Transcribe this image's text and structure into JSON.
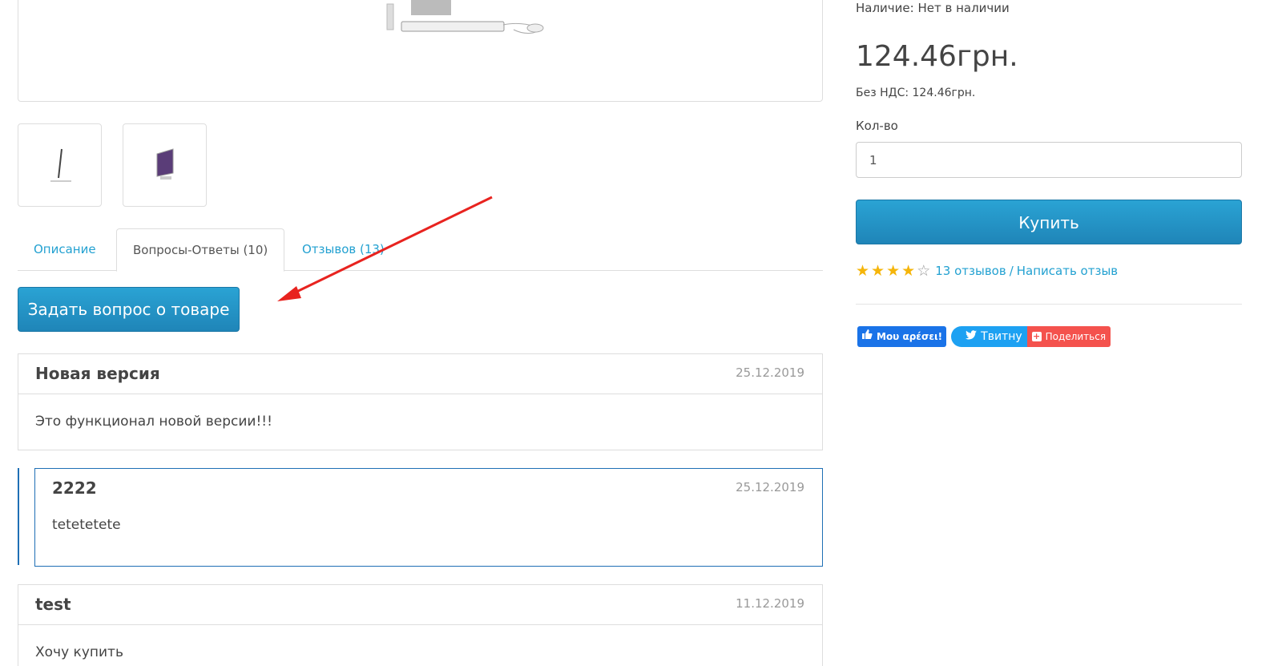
{
  "product": {
    "availability": "Наличие: Нет в наличии",
    "price": "124.46грн.",
    "price_no_vat": "Без НДС: 124.46грн.",
    "qty_label": "Кол-во",
    "qty_value": "1",
    "buy_label": "Купить",
    "rating": 4,
    "rating_max": 5,
    "reviews_link": "13 отзывов",
    "rating_separator": "/",
    "write_review_link": "Написать отзыв"
  },
  "social": {
    "like": "Μου αρέσει!",
    "tweet": "Твитну",
    "share": "Поделиться"
  },
  "tabs": [
    {
      "label": "Описание"
    },
    {
      "label": "Вопросы-Ответы (10)"
    },
    {
      "label": "Отзывов (13)"
    }
  ],
  "ask_button": "Задать вопрос о товаре",
  "questions": [
    {
      "title": "Новая версия",
      "date": "25.12.2019",
      "body": "Это функционал новой версии!!!"
    },
    {
      "title": "2222",
      "date": "25.12.2019",
      "body": "tetetetete"
    },
    {
      "title": "test",
      "date": "11.12.2019",
      "body": "Хочу купить"
    }
  ],
  "colors": {
    "accent": "#23a1d1",
    "button": "#2aa3d4",
    "star": "#f5b50a",
    "annotation_arrow": "#e8231f",
    "reply_border": "#1f6fb5"
  }
}
